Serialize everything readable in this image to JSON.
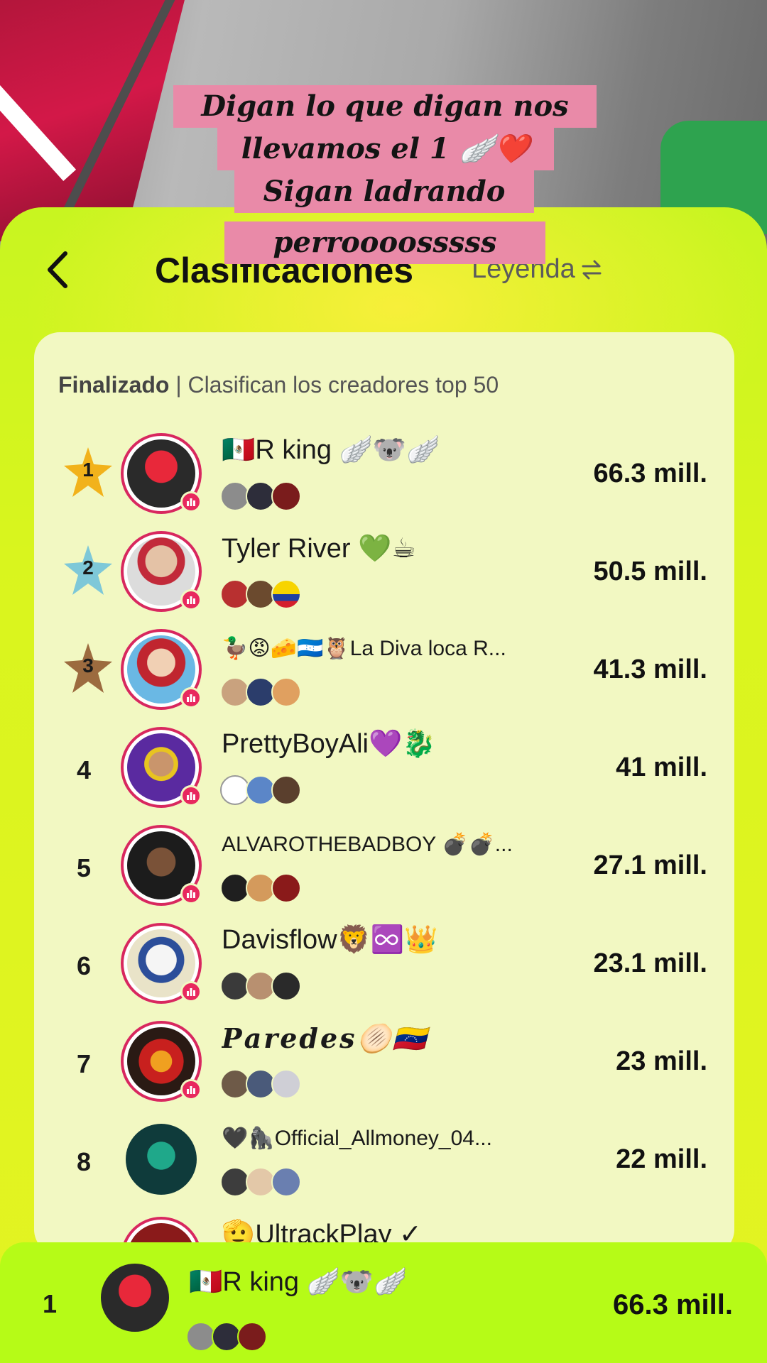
{
  "caption": {
    "lines": [
      "Digan lo que digan nos",
      "llevamos el 1 🪽❤️",
      "Sigan ladrando",
      "perroooosssss"
    ]
  },
  "header": {
    "title": "Clasificaciones",
    "legend_label": "Leyenda",
    "back_icon": "chevron-left-icon",
    "swap_icon": "swap-arrows-icon"
  },
  "board": {
    "status": "Finalizado",
    "subtitle": "| Clasifican los creadores top 50",
    "rows": [
      {
        "rank": "1",
        "name": "🇲🇽R king 🪽🐨🪽",
        "score": "66.3 mill.",
        "medal": "gold",
        "medal_color": "#f2b21b"
      },
      {
        "rank": "2",
        "name": "Tyler River 💚☕",
        "score": "50.5 mill.",
        "medal": "silver",
        "medal_color": "#7ec8d8"
      },
      {
        "rank": "3",
        "name": "🦆😡🧀🇭🇳🦉La Diva loca R...",
        "score": "41.3 mill.",
        "medal": "bronze",
        "medal_color": "#9c6b3f"
      },
      {
        "rank": "4",
        "name": "PrettyBoyAli💜🐉",
        "score": "41 mill."
      },
      {
        "rank": "5",
        "name": "ALVAROTHEBADBOY 💣💣...",
        "score": "27.1 mill."
      },
      {
        "rank": "6",
        "name": "Davisflow🦁♾️👑",
        "score": "23.1 mill."
      },
      {
        "rank": "7",
        "name": "𝑷𝒂𝒓𝒆𝒅𝒆𝒔🫓🇻🇪",
        "score": "23 mill."
      },
      {
        "rank": "8",
        "name": "🖤🦍Official_Allmoney_04...",
        "score": "22 mill."
      },
      {
        "rank": "",
        "name": "🫡UltrackPlay ✓",
        "score": ""
      }
    ]
  },
  "current_user": {
    "rank": "1",
    "name": "🇲🇽R king 🪽🐨🪽",
    "score": "66.3 mill."
  },
  "colors": {
    "panel": "#d4f51d",
    "card": "#f2f8c2",
    "accent_ring": "#d8285e",
    "bottom_bar": "#b6fb17",
    "caption_bg": "#e98aa8"
  }
}
